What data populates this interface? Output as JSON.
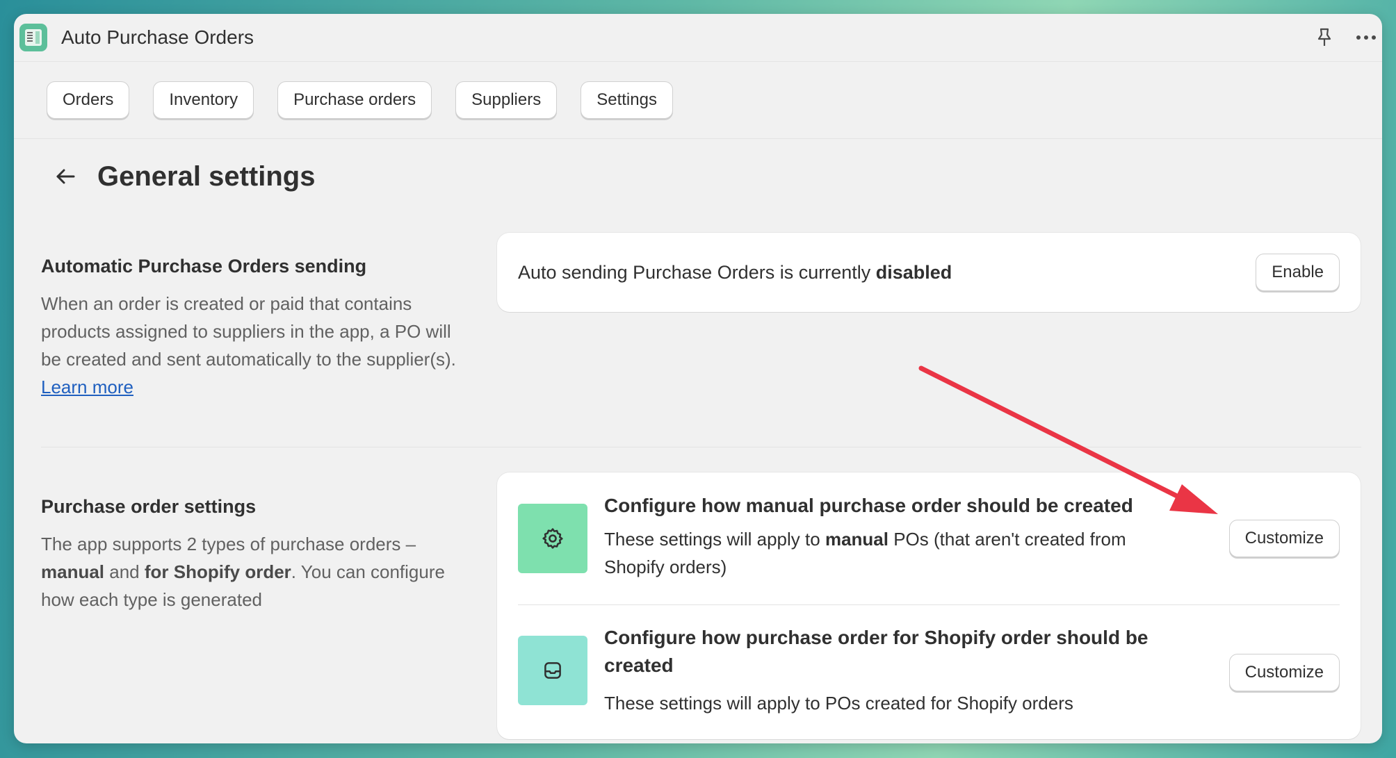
{
  "window": {
    "title": "Auto Purchase Orders"
  },
  "titlebar_icons": [
    "pin-icon",
    "more-icon"
  ],
  "nav": {
    "tabs": [
      {
        "label": "Orders"
      },
      {
        "label": "Inventory"
      },
      {
        "label": "Purchase orders"
      },
      {
        "label": "Suppliers"
      },
      {
        "label": "Settings"
      }
    ]
  },
  "page": {
    "title": "General settings"
  },
  "auto_sending": {
    "title": "Automatic Purchase Orders sending",
    "desc": "When an order is created or paid that contains products assigned to suppliers in the app, a PO will be created and sent automatically to the supplier(s).",
    "link": "Learn more",
    "status_prefix": "Auto sending Purchase Orders is currently",
    "status_value": "disabled",
    "button": "Enable"
  },
  "po_settings": {
    "title": "Purchase order settings",
    "desc_1": "The app supports 2 types of purchase orders –",
    "desc_bold_1": "manual",
    "desc_2": "and",
    "desc_bold_2": "for Shopify order",
    "desc_3": ". You can configure how each type is generated",
    "rows": [
      {
        "title": "Configure how manual purchase order should be created",
        "desc_1": "These settings will apply to",
        "desc_bold": "manual",
        "desc_2": "POs (that aren't created from Shopify orders)",
        "button": "Customize",
        "icon": "gear-icon",
        "icon_color": "#7ee0ae"
      },
      {
        "title": "Configure how purchase order for Shopify order should be created",
        "desc": "These settings will apply to POs created for Shopify orders",
        "button": "Customize",
        "icon": "inbox-icon",
        "icon_color": "#8fe3d4"
      }
    ]
  },
  "annotation": {
    "color": "#ea3545"
  }
}
